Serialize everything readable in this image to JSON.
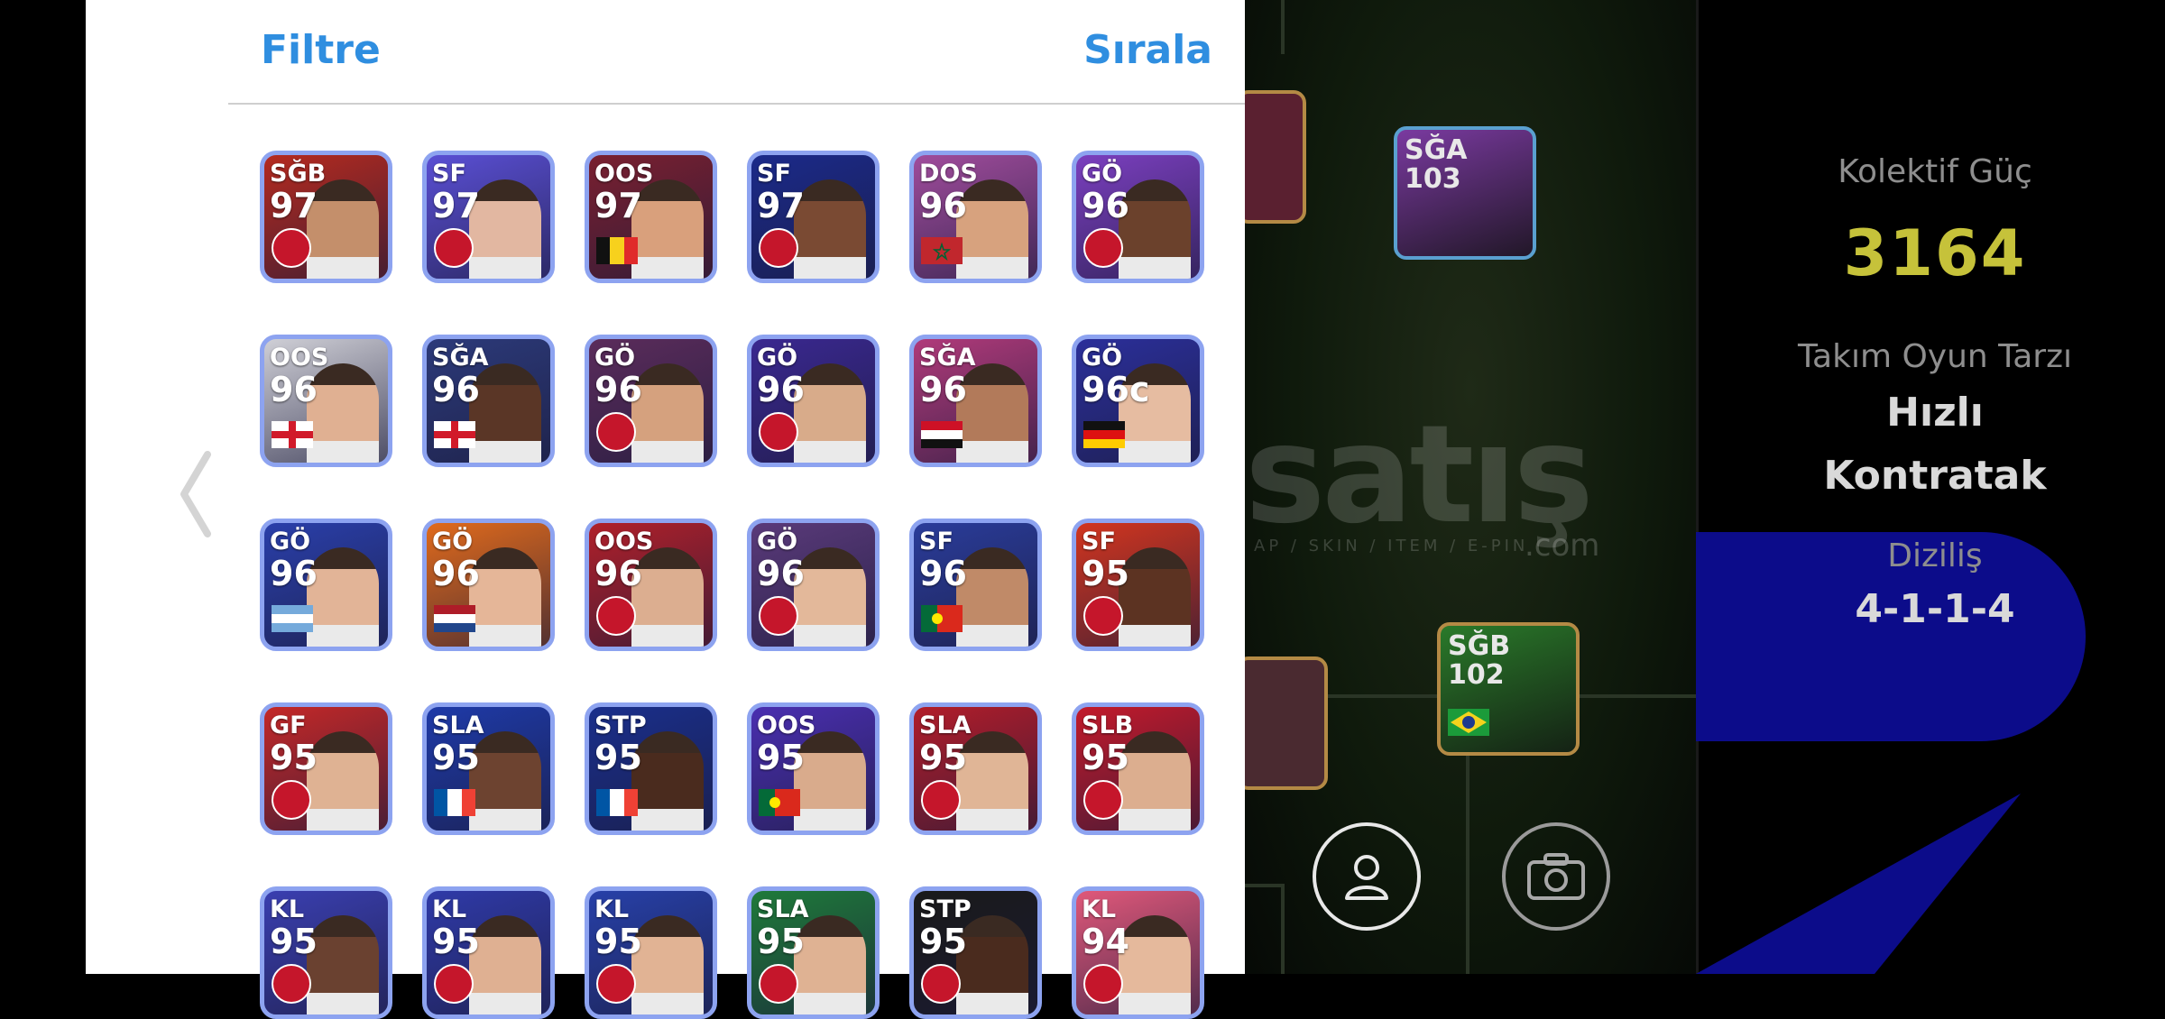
{
  "panel": {
    "filter_label": "Filtre",
    "sort_label": "Sırala"
  },
  "cards": [
    {
      "position": "SĞB",
      "rating": "97",
      "bg": "#b52a1f",
      "face": "#c48f6b",
      "emblem": "club"
    },
    {
      "position": "SF",
      "rating": "97",
      "bg": "#5a4fd4",
      "face": "#e2b7a1",
      "emblem": "club"
    },
    {
      "position": "OOS",
      "rating": "97",
      "bg": "#7a2030",
      "face": "#d9a07c",
      "emblem": "flag-be"
    },
    {
      "position": "SF",
      "rating": "97",
      "bg": "#1b2a8a",
      "face": "#7a4a33",
      "emblem": "club"
    },
    {
      "position": "DOS",
      "rating": "96",
      "bg": "#a04c9c",
      "face": "#d7a27e",
      "emblem": "flag-ma"
    },
    {
      "position": "GÖ",
      "rating": "96",
      "bg": "#7b3fbf",
      "face": "#6b412c",
      "emblem": "club"
    },
    {
      "position": "OOS",
      "rating": "96",
      "bg": "#cfcfd6",
      "face": "#e0b092",
      "emblem": "flag-en"
    },
    {
      "position": "SĞA",
      "rating": "96",
      "bg": "#2c3a7a",
      "face": "#5a3626",
      "emblem": "flag-en"
    },
    {
      "position": "GÖ",
      "rating": "96",
      "bg": "#5b2c5b",
      "face": "#d5a17e",
      "emblem": "club"
    },
    {
      "position": "GÖ",
      "rating": "96",
      "bg": "#3a2890",
      "face": "#d8ab8a",
      "emblem": "club"
    },
    {
      "position": "SĞA",
      "rating": "96",
      "bg": "#b03a7a",
      "face": "#b27a5a",
      "emblem": "flag-eg"
    },
    {
      "position": "GÖ",
      "rating": "96c",
      "bg": "#2b2f9a",
      "face": "#e6bca1",
      "emblem": "flag-de"
    },
    {
      "position": "GÖ",
      "rating": "96",
      "bg": "#2a3faa",
      "face": "#e2b497",
      "emblem": "flag-ar"
    },
    {
      "position": "GÖ",
      "rating": "96",
      "bg": "#e06a1c",
      "face": "#e5b698",
      "emblem": "flag-nl"
    },
    {
      "position": "OOS",
      "rating": "96",
      "bg": "#b0202a",
      "face": "#dcae90",
      "emblem": "club"
    },
    {
      "position": "GÖ",
      "rating": "96",
      "bg": "#5a3a7a",
      "face": "#e3b89a",
      "emblem": "club"
    },
    {
      "position": "SF",
      "rating": "96",
      "bg": "#2a3c9a",
      "face": "#c08a68",
      "emblem": "flag-pt"
    },
    {
      "position": "SF",
      "rating": "95",
      "bg": "#d2351f",
      "face": "#5c3322",
      "emblem": "club"
    },
    {
      "position": "GF",
      "rating": "95",
      "bg": "#c42828",
      "face": "#dfb293",
      "emblem": "club"
    },
    {
      "position": "SLA",
      "rating": "95",
      "bg": "#1e3aa8",
      "face": "#6d4330",
      "emblem": "flag-fr"
    },
    {
      "position": "STP",
      "rating": "95",
      "bg": "#1a2f8c",
      "face": "#4a2b1e",
      "emblem": "flag-fr"
    },
    {
      "position": "OOS",
      "rating": "95",
      "bg": "#4a2fb0",
      "face": "#d9ab8c",
      "emblem": "flag-pt"
    },
    {
      "position": "SLA",
      "rating": "95",
      "bg": "#b21d2a",
      "face": "#e0b596",
      "emblem": "club"
    },
    {
      "position": "SLB",
      "rating": "95",
      "bg": "#c31a2b",
      "face": "#dcae8f",
      "emblem": "club"
    },
    {
      "position": "KL",
      "rating": "95",
      "bg": "#3a3fb0",
      "face": "#6a4130",
      "emblem": "club"
    },
    {
      "position": "KL",
      "rating": "95",
      "bg": "#2f3aa8",
      "face": "#dfb092",
      "emblem": "club"
    },
    {
      "position": "KL",
      "rating": "95",
      "bg": "#2740a8",
      "face": "#e1b394",
      "emblem": "club"
    },
    {
      "position": "SLA",
      "rating": "95",
      "bg": "#1f7a3a",
      "face": "#dfb293",
      "emblem": "club"
    },
    {
      "position": "STP",
      "rating": "95",
      "bg": "#1a1a1a",
      "face": "#4a2b1e",
      "emblem": "club"
    },
    {
      "position": "KL",
      "rating": "94",
      "bg": "#e0587a",
      "face": "#e5b99c",
      "emblem": "club"
    }
  ],
  "pitch_cards": [
    {
      "position": "SĞA",
      "rating": "103",
      "bg": "#7a3aa0"
    },
    {
      "position": "SĞB",
      "rating": "102",
      "bg": "#2a7a2a"
    }
  ],
  "stats": {
    "power_label": "Kolektif Güç",
    "power_value": "3164",
    "style_label": "Takım Oyun Tarzı",
    "style_value_1": "Hızlı",
    "style_value_2": "Kontratak",
    "formation_label": "Diziliş",
    "formation_value": "4-1-1-4"
  },
  "watermark": {
    "main": "satış",
    "sub": "AP / SKIN / ITEM / E-PIN",
    "com": ".com"
  },
  "colors": {
    "accent_blue": "#2f8ee0",
    "power_yellow": "#c6c23a",
    "formation_blue": "#0c0c8a"
  }
}
